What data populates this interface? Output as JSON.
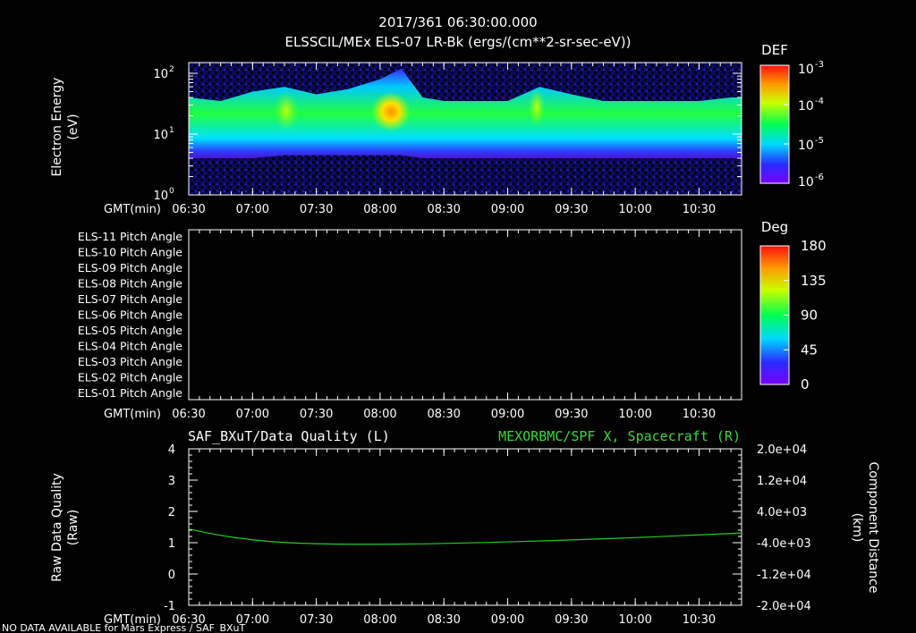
{
  "header": {
    "date_line": "2017/361 06:30:00.000",
    "title": "ELSSCIL/MEx ELS-07 LR-Bk  (ergs/(cm**2-sr-sec-eV))"
  },
  "time_axis": {
    "label": "GMT(min)",
    "ticks": [
      "06:30",
      "07:00",
      "07:30",
      "08:00",
      "08:30",
      "09:00",
      "09:30",
      "10:00",
      "10:30"
    ]
  },
  "panel1": {
    "ylabel_line1": "Electron Energy",
    "ylabel_line2": "(eV)",
    "y_ticks": [
      {
        "base": "10",
        "exp": "2"
      },
      {
        "base": "10",
        "exp": "1"
      },
      {
        "base": "10",
        "exp": "0"
      }
    ],
    "colorbar": {
      "label": "DEF",
      "ticks": [
        {
          "base": "10",
          "exp": "-3"
        },
        {
          "base": "10",
          "exp": "-4"
        },
        {
          "base": "10",
          "exp": "-5"
        },
        {
          "base": "10",
          "exp": "-6"
        }
      ]
    }
  },
  "panel2": {
    "row_labels": [
      "ELS-11 Pitch Angle",
      "ELS-10 Pitch Angle",
      "ELS-09 Pitch Angle",
      "ELS-08 Pitch Angle",
      "ELS-07 Pitch Angle",
      "ELS-06 Pitch Angle",
      "ELS-05 Pitch Angle",
      "ELS-04 Pitch Angle",
      "ELS-03 Pitch Angle",
      "ELS-02 Pitch Angle",
      "ELS-01 Pitch Angle"
    ],
    "colorbar": {
      "label": "Deg",
      "ticks": [
        "180",
        "135",
        "90",
        "45",
        "0"
      ]
    }
  },
  "panel3": {
    "title_left": "SAF_BXuT/Data Quality (L)",
    "title_right": "MEXORBMC/SPF X, Spacecraft (R)",
    "ylabel_left_line1": "Raw Data Quality",
    "ylabel_left_line2": "(Raw)",
    "ylabel_right_line1": "Component Distance",
    "ylabel_right_line2": "(km)",
    "left_ticks": [
      "4",
      "3",
      "2",
      "1",
      "0",
      "-1"
    ],
    "right_ticks": [
      "2.0e+04",
      "1.2e+04",
      "4.0e+03",
      "-4.0e+03",
      "-1.2e+04",
      "-2.0e+04"
    ]
  },
  "footer": {
    "note": "NO DATA AVAILABLE for Mars Express / SAF_BXuT"
  },
  "colors": {
    "background": "#000000",
    "axes": "#ffffff",
    "line": "#22cc22",
    "right_title": "#33dd33"
  },
  "chart_data": [
    {
      "type": "heatmap",
      "title": "ELSSCIL/MEx ELS-07 LR-Bk  (ergs/(cm**2-sr-sec-eV))",
      "xlabel": "GMT(min)",
      "ylabel": "Electron Energy (eV)",
      "y_scale": "log",
      "ylim": [
        1,
        150
      ],
      "x_range": [
        "06:30",
        "10:50"
      ],
      "colorbar": {
        "label": "DEF",
        "scale": "log",
        "range": [
          1e-06,
          0.001
        ]
      },
      "band": {
        "x": [
          "06:30",
          "06:45",
          "07:00",
          "07:15",
          "07:30",
          "07:45",
          "08:00",
          "08:10",
          "08:20",
          "08:30",
          "08:45",
          "09:00",
          "09:15",
          "09:30",
          "09:45",
          "10:00",
          "10:15",
          "10:30",
          "10:45"
        ],
        "low_eV": [
          4,
          4,
          4,
          4.5,
          4.5,
          4.5,
          4.5,
          4.5,
          4,
          4,
          4,
          4,
          4,
          4,
          4,
          4,
          4,
          4,
          4
        ],
        "high_eV": [
          40,
          35,
          50,
          60,
          45,
          55,
          80,
          120,
          40,
          35,
          35,
          35,
          60,
          45,
          35,
          35,
          35,
          35,
          40
        ],
        "peak_log10_DEF": [
          -5.2,
          -5.0,
          -4.4,
          -4.2,
          -4.2,
          -4.0,
          -3.6,
          -3.9,
          -4.6,
          -4.8,
          -4.8,
          -4.8,
          -4.3,
          -4.6,
          -4.8,
          -4.8,
          -4.8,
          -4.7,
          -4.7
        ]
      }
    },
    {
      "type": "heatmap",
      "title": "",
      "xlabel": "GMT(min)",
      "rows": [
        "ELS-11 Pitch Angle",
        "ELS-10 Pitch Angle",
        "ELS-09 Pitch Angle",
        "ELS-08 Pitch Angle",
        "ELS-07 Pitch Angle",
        "ELS-06 Pitch Angle",
        "ELS-05 Pitch Angle",
        "ELS-04 Pitch Angle",
        "ELS-03 Pitch Angle",
        "ELS-02 Pitch Angle",
        "ELS-01 Pitch Angle"
      ],
      "colorbar": {
        "label": "Deg",
        "range": [
          0,
          180
        ]
      },
      "values": []
    },
    {
      "type": "line",
      "title_left": "SAF_BXuT/Data Quality (L)",
      "title_right": "MEXORBMC/SPF X, Spacecraft (R)",
      "xlabel": "GMT(min)",
      "ylabel_left": "Raw Data Quality (Raw)",
      "ylabel_right": "Component Distance (km)",
      "ylim_left": [
        -1,
        4
      ],
      "ylim_right": [
        -20000,
        20000
      ],
      "series": [
        {
          "name": "MEXORBMC/SPF X, Spacecraft (R)",
          "axis": "right",
          "x": [
            "06:30",
            "06:45",
            "07:00",
            "07:15",
            "07:30",
            "07:45",
            "08:00",
            "08:15",
            "08:30",
            "08:45",
            "09:00",
            "09:15",
            "09:30",
            "09:45",
            "10:00",
            "10:15",
            "10:30",
            "10:45",
            "10:50"
          ],
          "values": [
            -500,
            -2200,
            -3300,
            -4000,
            -4300,
            -4400,
            -4400,
            -4350,
            -4200,
            -4000,
            -3800,
            -3550,
            -3300,
            -3000,
            -2700,
            -2350,
            -2000,
            -1650,
            -1500
          ]
        }
      ]
    }
  ]
}
